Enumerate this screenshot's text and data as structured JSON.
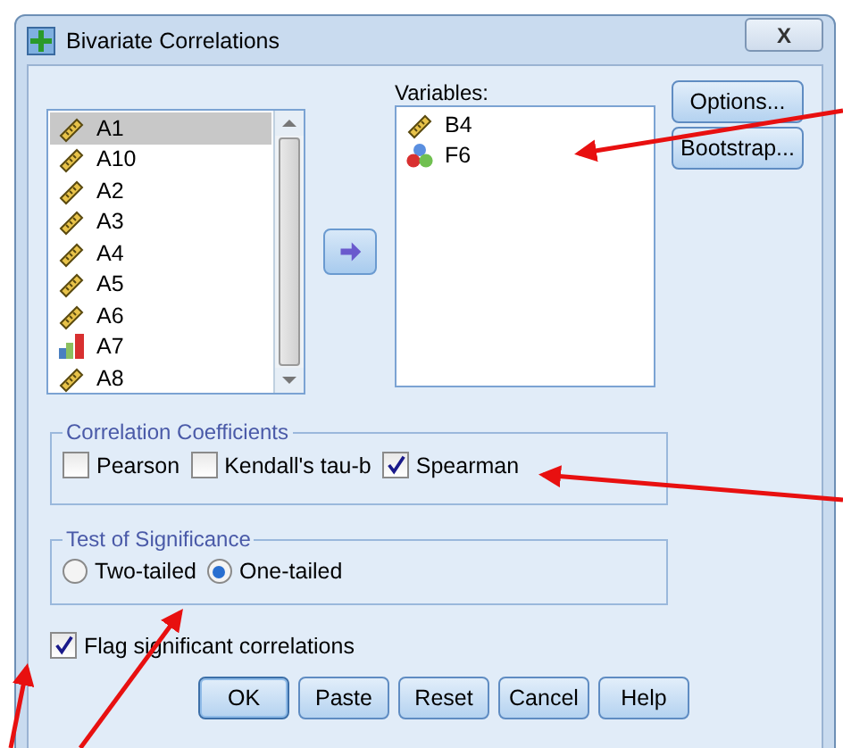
{
  "window": {
    "title": "Bivariate Correlations",
    "close": "X"
  },
  "source_list": {
    "items": [
      {
        "name": "A1",
        "kind": "scale",
        "selected": true
      },
      {
        "name": "A10",
        "kind": "scale",
        "selected": false
      },
      {
        "name": "A2",
        "kind": "scale",
        "selected": false
      },
      {
        "name": "A3",
        "kind": "scale",
        "selected": false
      },
      {
        "name": "A4",
        "kind": "scale",
        "selected": false
      },
      {
        "name": "A5",
        "kind": "scale",
        "selected": false
      },
      {
        "name": "A6",
        "kind": "scale",
        "selected": false
      },
      {
        "name": "A7",
        "kind": "ordinal",
        "selected": false
      },
      {
        "name": "A8",
        "kind": "scale",
        "selected": false
      }
    ]
  },
  "variables": {
    "label": "Variables:",
    "items": [
      {
        "name": "B4",
        "kind": "scale"
      },
      {
        "name": "F6",
        "kind": "nominal"
      }
    ]
  },
  "side_buttons": [
    "Options...",
    "Bootstrap..."
  ],
  "correlation_coefficients": {
    "title": "Correlation Coefficients",
    "options": [
      {
        "label": "Pearson",
        "checked": false
      },
      {
        "label": "Kendall's tau-b",
        "checked": false
      },
      {
        "label": "Spearman",
        "checked": true
      }
    ]
  },
  "test_of_significance": {
    "title": "Test of Significance",
    "options": [
      {
        "label": "Two-tailed",
        "selected": false
      },
      {
        "label": "One-tailed",
        "selected": true
      }
    ]
  },
  "flag_significant": {
    "label": "Flag significant correlations",
    "checked": true
  },
  "buttons": [
    "OK",
    "Paste",
    "Reset",
    "Cancel",
    "Help"
  ]
}
